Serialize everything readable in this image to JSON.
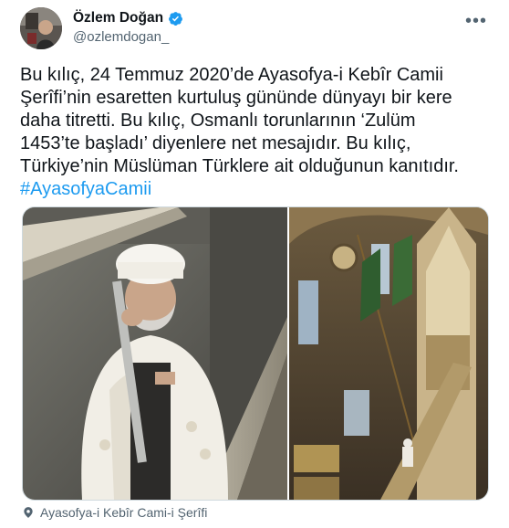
{
  "tweet": {
    "author": {
      "display_name": "Özlem Doğan",
      "handle": "@ozlemdogan_",
      "verified_icon": "verified-badge-icon"
    },
    "more_icon": "more-horizontal-icon",
    "text_lines": [
      "Bu kılıç, 24 Temmuz 2020’de Ayasofya-i Kebîr Camii",
      "Şerîfi’nin esaretten kurtuluş gününde dünyayı bir kere",
      "daha titretti. Bu kılıç, Osmanlı torunlarının ‘Zulüm",
      "1453’te başladı’ diyenlere net mesajıdır. Bu kılıç,",
      "Türkiye’nin Müslüman Türklere ait olduğunun kanıtıdır."
    ],
    "hashtag": "#AyasofyaCamii",
    "location": "Ayasofya-i Kebîr Cami-i Şerîfi",
    "location_icon": "location-pin-icon",
    "colors": {
      "accent": "#1d9bf0",
      "secondary_text": "#536471",
      "primary_text": "#0f1419"
    }
  }
}
